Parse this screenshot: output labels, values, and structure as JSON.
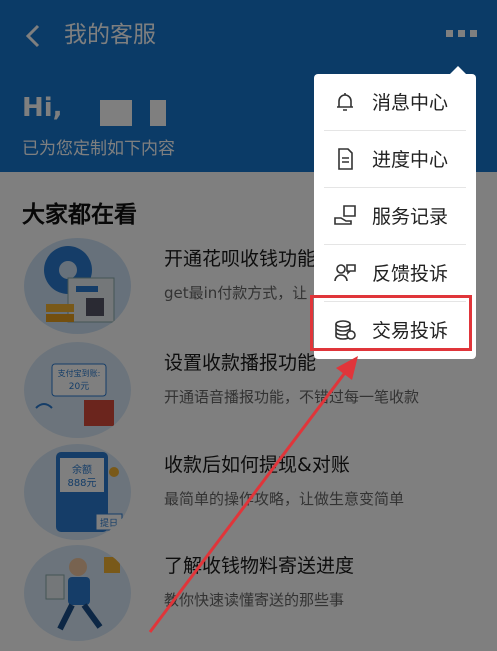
{
  "header": {
    "title": "我的客服",
    "greeting": "Hi,",
    "subtitle": "已为您定制如下内容"
  },
  "section": {
    "title": "大家都在看"
  },
  "articles": [
    {
      "title": "开通花呗收钱功能",
      "desc": "get最in付款方式，让"
    },
    {
      "title": "设置收款播报功能",
      "desc": "开通语音播报功能，不错过每一笔收款"
    },
    {
      "title": "收款后如何提现&对账",
      "desc": "最简单的操作攻略，让做生意变简单"
    },
    {
      "title": "了解收钱物料寄送进度",
      "desc": "教你快速读懂寄送的那些事"
    }
  ],
  "thumbs": {
    "t2_label": "支付宝到账:",
    "t2_amount": "20元",
    "t3_label": "余额",
    "t3_amount": "888元",
    "t3_tag": "提日"
  },
  "menu": {
    "items": [
      {
        "label": "消息中心",
        "icon": "bell-icon"
      },
      {
        "label": "进度中心",
        "icon": "document-icon"
      },
      {
        "label": "服务记录",
        "icon": "hand-card-icon"
      },
      {
        "label": "反馈投诉",
        "icon": "person-chat-icon"
      },
      {
        "label": "交易投诉",
        "icon": "coins-icon"
      }
    ],
    "highlighted": "交易投诉"
  },
  "colors": {
    "brand_blue": "#1677cf",
    "annotation_red": "#e0353a"
  }
}
